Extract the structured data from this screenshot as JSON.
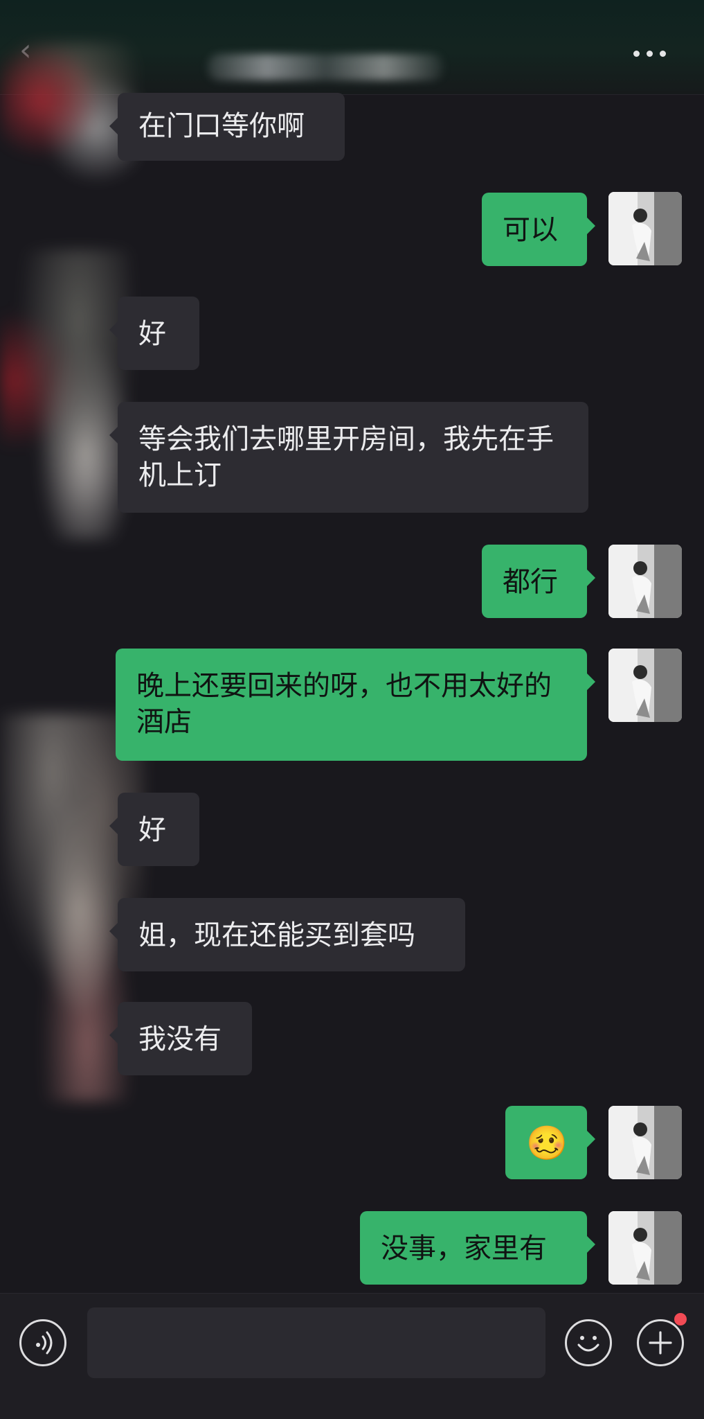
{
  "header": {
    "back_icon": "chevron-left-icon",
    "more_icon": "more-horizontal-icon"
  },
  "messages": [
    {
      "side": "in",
      "text": "在门口等你啊"
    },
    {
      "side": "out",
      "text": "可以"
    },
    {
      "side": "in",
      "text": "好"
    },
    {
      "side": "in",
      "text": "等会我们去哪里开房间，我先在手机上订"
    },
    {
      "side": "out",
      "text": "都行"
    },
    {
      "side": "out",
      "text": "晚上还要回来的呀，也不用太好的酒店"
    },
    {
      "side": "in",
      "text": "好"
    },
    {
      "side": "in",
      "text": "姐，现在还能买到套吗"
    },
    {
      "side": "in",
      "text": "我没有"
    },
    {
      "side": "out",
      "text": "🥴"
    },
    {
      "side": "out",
      "text": "没事，家里有"
    }
  ],
  "input_bar": {
    "voice_icon": "voice-icon",
    "emoji_icon": "emoji-icon",
    "plus_icon": "plus-icon",
    "placeholder": "",
    "notification_color": "#f24b55"
  }
}
